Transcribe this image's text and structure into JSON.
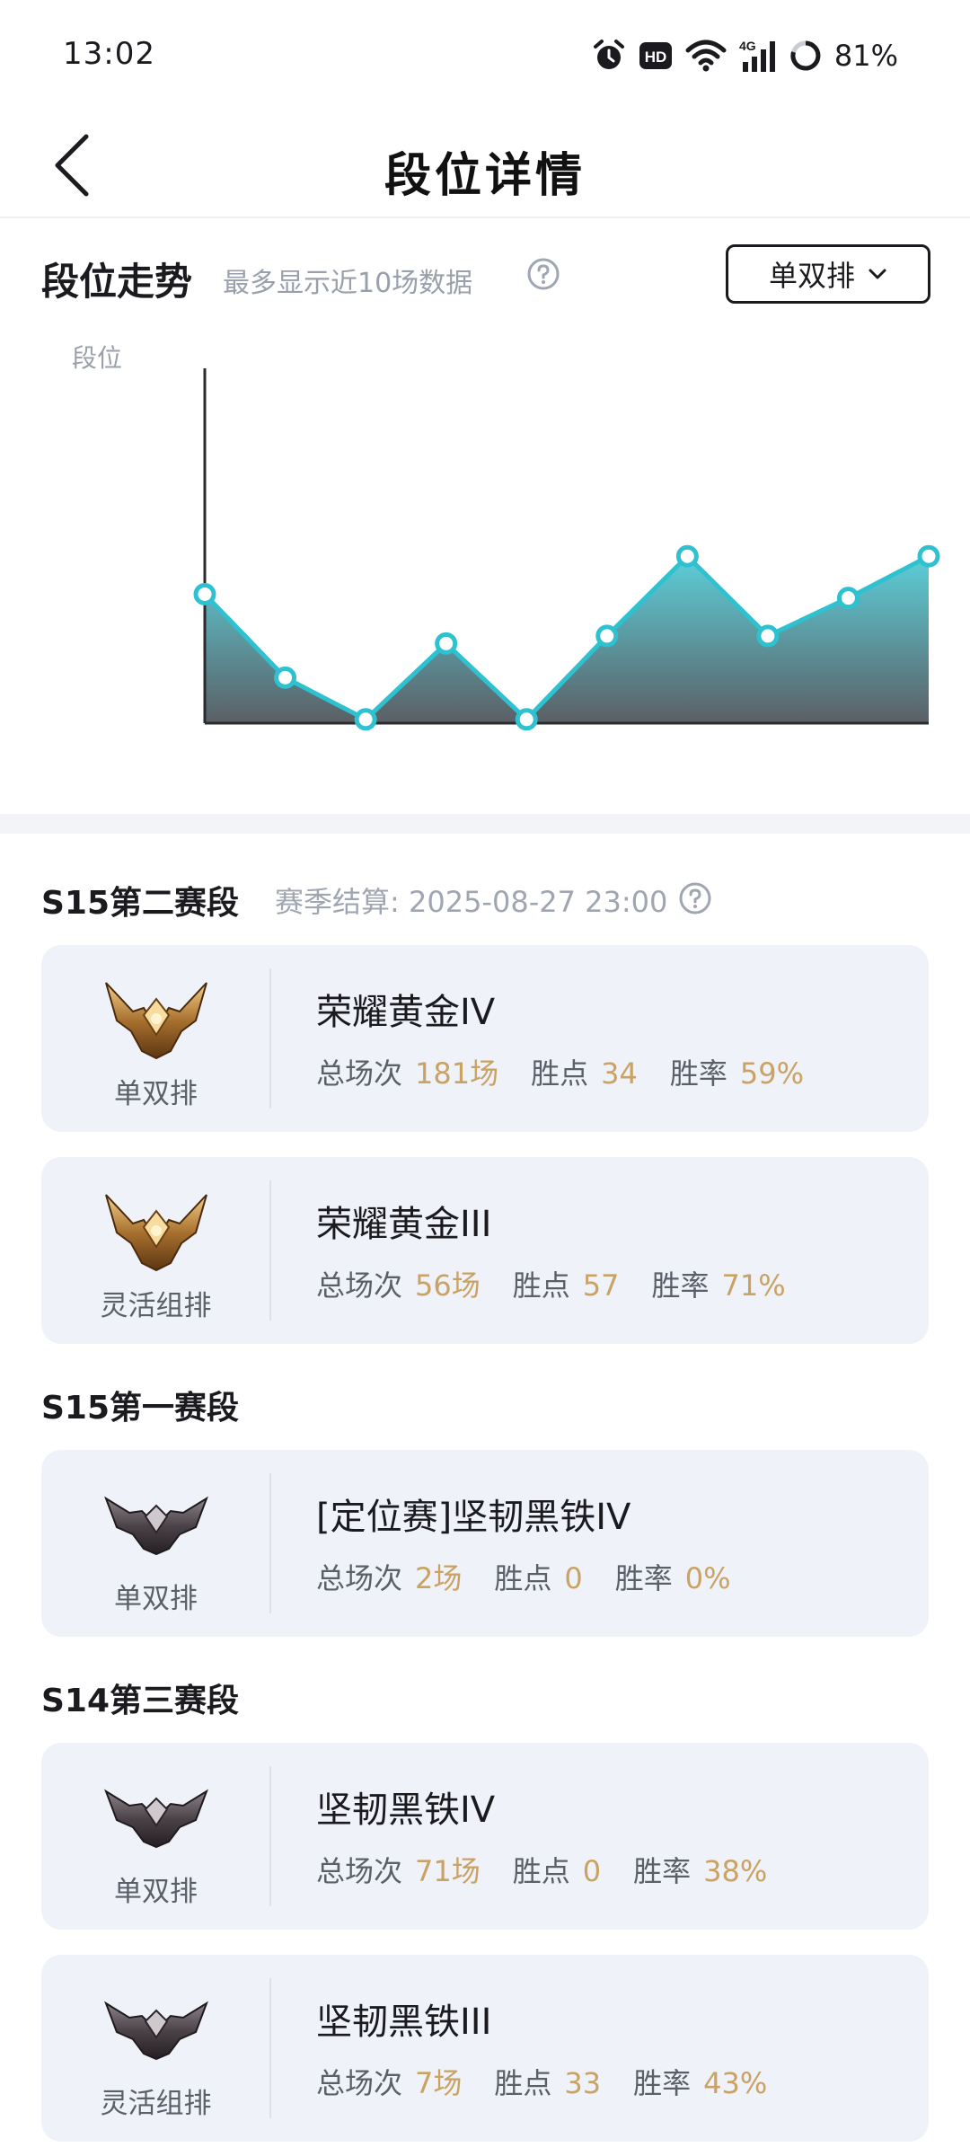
{
  "status_bar": {
    "time": "13:02",
    "battery": "81%",
    "hd": "HD",
    "network": "4G"
  },
  "nav": {
    "title": "段位详情"
  },
  "trend": {
    "title": "段位走势",
    "subtitle": "最多显示近10场数据",
    "mode_select": "单双排",
    "y_label": "段位"
  },
  "chart_data": {
    "type": "area",
    "x": [
      1,
      2,
      3,
      4,
      5,
      6,
      7,
      8,
      9,
      10
    ],
    "values": [
      3.4,
      1.2,
      0.1,
      2.1,
      0.1,
      2.3,
      4.4,
      2.3,
      3.3,
      4.4
    ],
    "ylim": [
      0,
      9
    ],
    "ylabel": "段位",
    "grid": false,
    "colors": {
      "line": "#2ec1d0",
      "fill_top": "#5ccfd9",
      "fill_bottom": "#5b5f65",
      "point_fill": "#ffffff"
    }
  },
  "seasons": [
    {
      "title": "S15第二赛段",
      "settle": "赛季结算: 2025-08-27 23:00",
      "cards": [
        {
          "mode": "单双排",
          "rank": "荣耀黄金IV",
          "games_label": "总场次",
          "games": "181场",
          "points_label": "胜点",
          "points": "34",
          "winrate_label": "胜率",
          "winrate": "59%",
          "emblem": "gold"
        },
        {
          "mode": "灵活组排",
          "rank": "荣耀黄金III",
          "games_label": "总场次",
          "games": "56场",
          "points_label": "胜点",
          "points": "57",
          "winrate_label": "胜率",
          "winrate": "71%",
          "emblem": "gold"
        }
      ]
    },
    {
      "title": "S15第一赛段",
      "cards": [
        {
          "mode": "单双排",
          "rank": "[定位赛]坚韧黑铁IV",
          "games_label": "总场次",
          "games": "2场",
          "points_label": "胜点",
          "points": "0",
          "winrate_label": "胜率",
          "winrate": "0%",
          "emblem": "iron"
        }
      ]
    },
    {
      "title": "S14第三赛段",
      "cards": [
        {
          "mode": "单双排",
          "rank": "坚韧黑铁IV",
          "games_label": "总场次",
          "games": "71场",
          "points_label": "胜点",
          "points": "0",
          "winrate_label": "胜率",
          "winrate": "38%",
          "emblem": "iron"
        },
        {
          "mode": "灵活组排",
          "rank": "坚韧黑铁III",
          "games_label": "总场次",
          "games": "7场",
          "points_label": "胜点",
          "points": "33",
          "winrate_label": "胜率",
          "winrate": "43%",
          "emblem": "iron"
        }
      ]
    }
  ]
}
